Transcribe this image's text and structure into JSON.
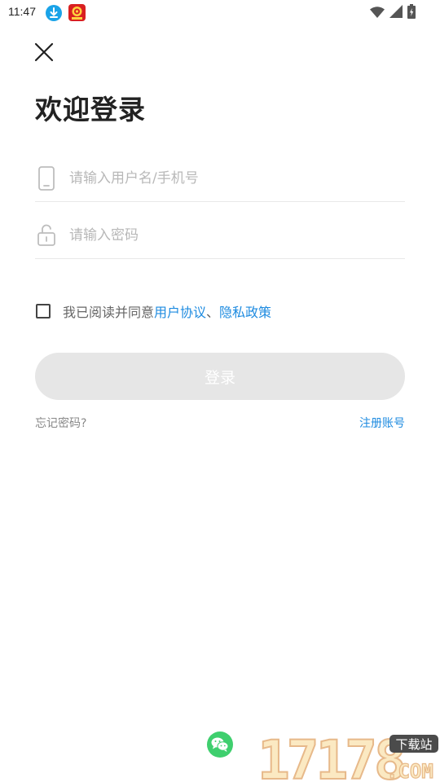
{
  "status_bar": {
    "time": "11:47"
  },
  "login": {
    "title": "欢迎登录",
    "phone_placeholder": "请输入用户名/手机号",
    "password_placeholder": "请输入密码",
    "agreement_prefix": "我已阅读并同意",
    "user_agreement": "用户协议",
    "separator": "、",
    "privacy_policy": "隐私政策",
    "login_button": "登录",
    "forgot_password": "忘记密码?",
    "register": "注册账号",
    "agreement_checked": false
  },
  "watermark": {
    "number": "17178",
    "tag": "下载站",
    "domain": ".COM"
  },
  "colors": {
    "accent": "#1e8be0",
    "button_disabled": "#e6e6e6",
    "wechat": "#3fcf6e"
  },
  "icons": [
    "download-icon",
    "app-notification-icon",
    "wifi-icon",
    "signal-icon",
    "battery-icon",
    "close-icon",
    "phone-icon",
    "lock-icon",
    "checkbox-icon",
    "wechat-icon"
  ]
}
